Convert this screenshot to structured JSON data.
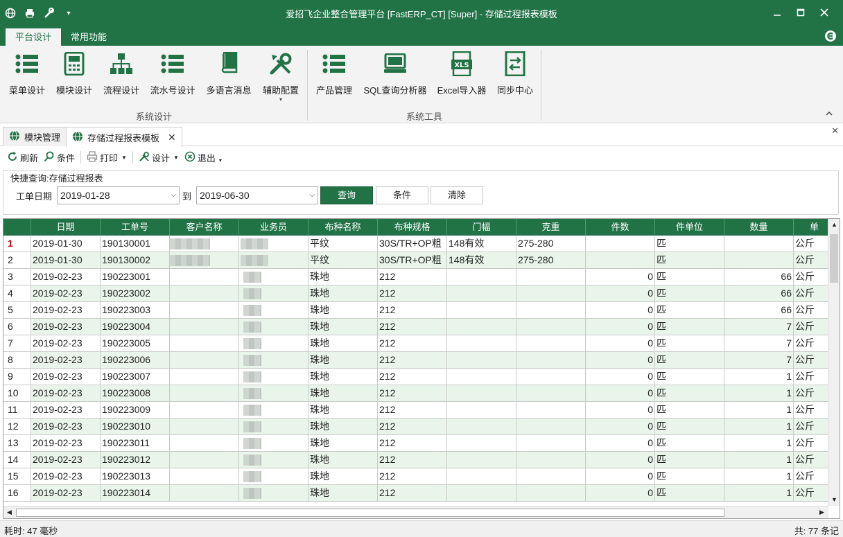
{
  "window": {
    "title": "爱招飞企业整合管理平台 [FastERP_CT] [Super] - 存储过程报表模板",
    "quick_access": [
      "globe-icon",
      "printer-icon",
      "tools-icon",
      "dropdown-icon"
    ]
  },
  "ribbon": {
    "tabs": [
      {
        "label": "平台设计",
        "active": true
      },
      {
        "label": "常用功能",
        "active": false
      }
    ],
    "groups": [
      {
        "label": "系统设计",
        "buttons": [
          {
            "label": "菜单设计",
            "icon": "list-icon"
          },
          {
            "label": "模块设计",
            "icon": "calculator-icon"
          },
          {
            "label": "流程设计",
            "icon": "org-chart-icon"
          },
          {
            "label": "流水号设计",
            "icon": "numbered-list-icon"
          },
          {
            "label": "多语言消息",
            "icon": "book-icon"
          },
          {
            "label": "辅助配置",
            "icon": "tools-icon"
          }
        ]
      },
      {
        "label": "系统工具",
        "buttons": [
          {
            "label": "产品管理",
            "icon": "list-icon"
          },
          {
            "label": "SQL查询分析器",
            "icon": "computer-icon"
          },
          {
            "label": "Excel导入器",
            "icon": "xls-icon"
          },
          {
            "label": "同步中心",
            "icon": "sync-icon"
          }
        ]
      }
    ]
  },
  "doc_tabs": [
    {
      "label": "模块管理",
      "active": false
    },
    {
      "label": "存储过程报表模板",
      "active": true
    }
  ],
  "toolbar": {
    "refresh": "刷新",
    "condition": "条件",
    "print": "打印",
    "design": "设计",
    "exit": "退出"
  },
  "query": {
    "legend": "快捷查询:存储过程报表",
    "date_label": "工单日期",
    "from_date": "2019-01-28",
    "to_label": "到",
    "to_date": "2019-06-30",
    "query_button": "查询",
    "condition_button": "条件",
    "clear_button": "清除"
  },
  "grid": {
    "columns": [
      "日期",
      "工单号",
      "客户名称",
      "业务员",
      "布种名称",
      "布种规格",
      "门幅",
      "克重",
      "件数",
      "件单位",
      "数量",
      "单"
    ],
    "rows": [
      [
        "1",
        "2019-01-30",
        "190130001",
        "",
        "",
        "平纹",
        "30S/TR+OP粗",
        "148有效",
        "275-280",
        "",
        "匹",
        "",
        "公斤"
      ],
      [
        "2",
        "2019-01-30",
        "190130002",
        "",
        "",
        "平纹",
        "30S/TR+OP粗",
        "148有效",
        "275-280",
        "",
        "匹",
        "",
        "公斤"
      ],
      [
        "3",
        "2019-02-23",
        "190223001",
        "",
        "",
        "珠地",
        "212",
        "",
        "",
        "0",
        "匹",
        "66",
        "公斤"
      ],
      [
        "4",
        "2019-02-23",
        "190223002",
        "",
        "",
        "珠地",
        "212",
        "",
        "",
        "0",
        "匹",
        "66",
        "公斤"
      ],
      [
        "5",
        "2019-02-23",
        "190223003",
        "",
        "",
        "珠地",
        "212",
        "",
        "",
        "0",
        "匹",
        "66",
        "公斤"
      ],
      [
        "6",
        "2019-02-23",
        "190223004",
        "",
        "",
        "珠地",
        "212",
        "",
        "",
        "0",
        "匹",
        "7",
        "公斤"
      ],
      [
        "7",
        "2019-02-23",
        "190223005",
        "",
        "",
        "珠地",
        "212",
        "",
        "",
        "0",
        "匹",
        "7",
        "公斤"
      ],
      [
        "8",
        "2019-02-23",
        "190223006",
        "",
        "",
        "珠地",
        "212",
        "",
        "",
        "0",
        "匹",
        "7",
        "公斤"
      ],
      [
        "9",
        "2019-02-23",
        "190223007",
        "",
        "",
        "珠地",
        "212",
        "",
        "",
        "0",
        "匹",
        "1",
        "公斤"
      ],
      [
        "10",
        "2019-02-23",
        "190223008",
        "",
        "",
        "珠地",
        "212",
        "",
        "",
        "0",
        "匹",
        "1",
        "公斤"
      ],
      [
        "11",
        "2019-02-23",
        "190223009",
        "",
        "",
        "珠地",
        "212",
        "",
        "",
        "0",
        "匹",
        "1",
        "公斤"
      ],
      [
        "12",
        "2019-02-23",
        "190223010",
        "",
        "",
        "珠地",
        "212",
        "",
        "",
        "0",
        "匹",
        "1",
        "公斤"
      ],
      [
        "13",
        "2019-02-23",
        "190223011",
        "",
        "",
        "珠地",
        "212",
        "",
        "",
        "0",
        "匹",
        "1",
        "公斤"
      ],
      [
        "14",
        "2019-02-23",
        "190223012",
        "",
        "",
        "珠地",
        "212",
        "",
        "",
        "0",
        "匹",
        "1",
        "公斤"
      ],
      [
        "15",
        "2019-02-23",
        "190223013",
        "",
        "",
        "珠地",
        "212",
        "",
        "",
        "0",
        "匹",
        "1",
        "公斤"
      ],
      [
        "16",
        "2019-02-23",
        "190223014",
        "",
        "",
        "珠地",
        "212",
        "",
        "",
        "0",
        "匹",
        "1",
        "公斤"
      ]
    ]
  },
  "status": {
    "elapsed": "耗时: 47 毫秒",
    "total": "共: 77 条记"
  },
  "colors": {
    "accent": "#217346",
    "row_alt": "#e9f5ea",
    "current_row_marker": "#c00000"
  }
}
